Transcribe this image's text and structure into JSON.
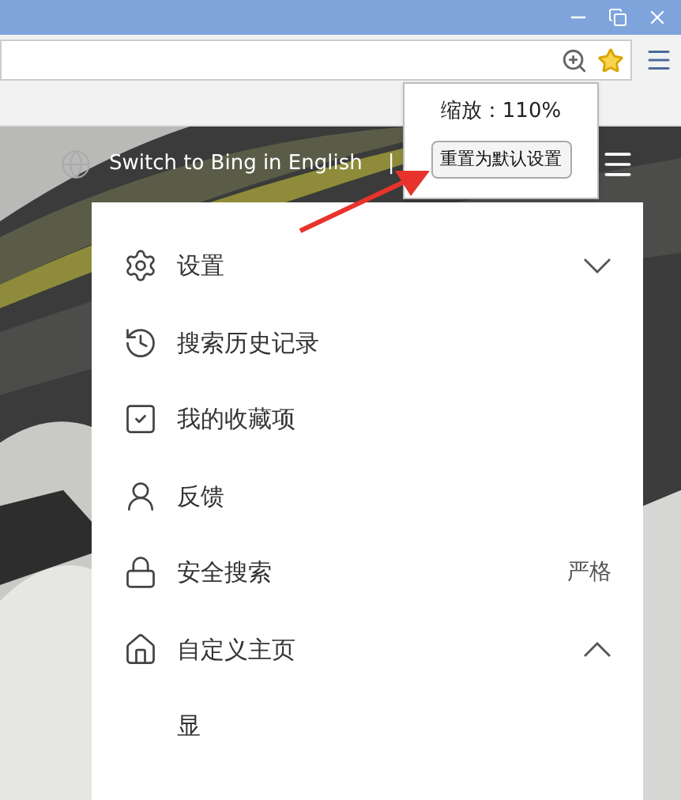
{
  "browser": {
    "zoom_popup": {
      "label": "缩放：110%",
      "reset_button": "重置为默认设置"
    }
  },
  "bing_header": {
    "switch_link": "Switch to Bing in English",
    "separator": "|"
  },
  "menu": {
    "items": [
      {
        "kind": "expandable",
        "label": "设置",
        "expanded": false
      },
      {
        "kind": "link",
        "label": "搜索历史记录"
      },
      {
        "kind": "link",
        "label": "我的收藏项"
      },
      {
        "kind": "link",
        "label": "反馈"
      },
      {
        "kind": "value",
        "label": "安全搜索",
        "value": "严格"
      },
      {
        "kind": "expandable",
        "label": "自定义主页",
        "expanded": true,
        "children": [
          {
            "label": "显"
          }
        ]
      }
    ]
  }
}
